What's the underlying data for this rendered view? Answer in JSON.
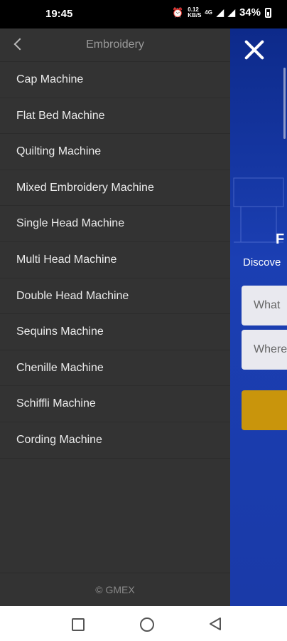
{
  "status": {
    "time": "19:45",
    "speed": "0.12 KB/S",
    "network": "4G",
    "battery": "34%"
  },
  "drawer": {
    "title": "Embroidery",
    "items": [
      "Cap Machine",
      "Flat Bed Machine",
      "Quilting Machine",
      "Mixed Embroidery Machine",
      "Single Head Machine",
      "Multi Head Machine",
      "Double Head Machine",
      "Sequins Machine",
      "Chenille Machine",
      "Schiffli Machine",
      "Cording Machine"
    ],
    "footer": "© GMEX"
  },
  "background": {
    "hero_title": "F",
    "hero_sub": "Discove",
    "what_placeholder": "What",
    "where_placeholder": "Where"
  },
  "colors": {
    "drawer_bg": "#333333",
    "page_bg": "#1b3fb3",
    "search_button": "#c9950c"
  }
}
